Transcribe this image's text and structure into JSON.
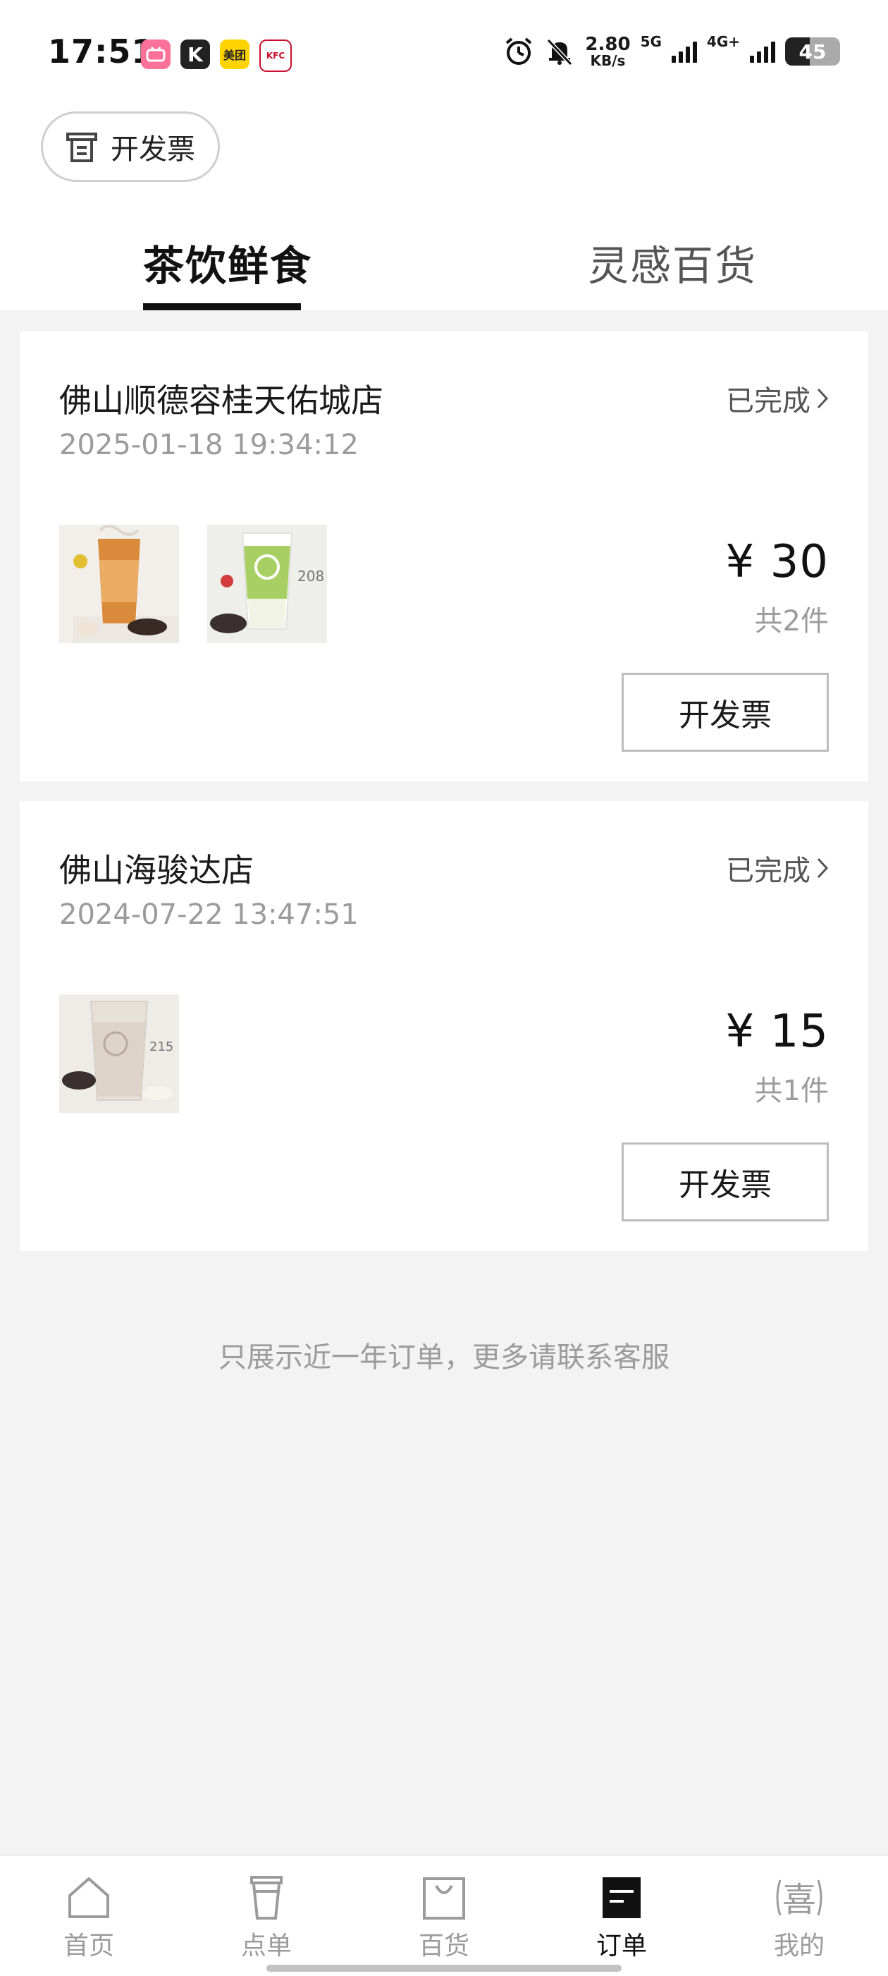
{
  "status_bar": {
    "time": "17:51",
    "apps": [
      "bilibili",
      "K",
      "美团",
      "KFC"
    ],
    "net_speed_value": "2.80",
    "net_speed_unit": "KB/s",
    "net_5g": "5G",
    "net_4g": "4G+",
    "battery": "45",
    "battery_level": 0.45
  },
  "header": {
    "invoice_label": "开发票"
  },
  "tabs": [
    {
      "label": "茶饮鲜食",
      "active": true
    },
    {
      "label": "灵感百货",
      "active": false
    }
  ],
  "orders": [
    {
      "store": "佛山顺德容桂天佑城店",
      "time": "2025-01-18 19:34:12",
      "status": "已完成",
      "price": "¥ 30",
      "count": "共2件",
      "invoice_label": "开发票",
      "thumbs": [
        "milk-tea-thumb",
        "green-tea-thumb"
      ]
    },
    {
      "store": "佛山海骏达店",
      "time": "2024-07-22 13:47:51",
      "status": "已完成",
      "price": "¥ 15",
      "count": "共1件",
      "invoice_label": "开发票",
      "thumbs": [
        "tea-latte-thumb"
      ]
    }
  ],
  "footer_note": "只展示近一年订单，更多请联系客服",
  "nav": [
    {
      "label": "首页",
      "icon": "home-icon",
      "active": false
    },
    {
      "label": "点单",
      "icon": "cup-icon",
      "active": false
    },
    {
      "label": "百货",
      "icon": "bag-icon",
      "active": false
    },
    {
      "label": "订单",
      "icon": "order-icon",
      "active": true
    },
    {
      "label": "我的",
      "icon": "profile-xi-icon",
      "active": false
    }
  ],
  "colors": {
    "background": "#f3f3f3",
    "card": "#ffffff",
    "text_primary": "#1a1a1a",
    "text_secondary": "#9b9b9b",
    "active": "#111111"
  }
}
